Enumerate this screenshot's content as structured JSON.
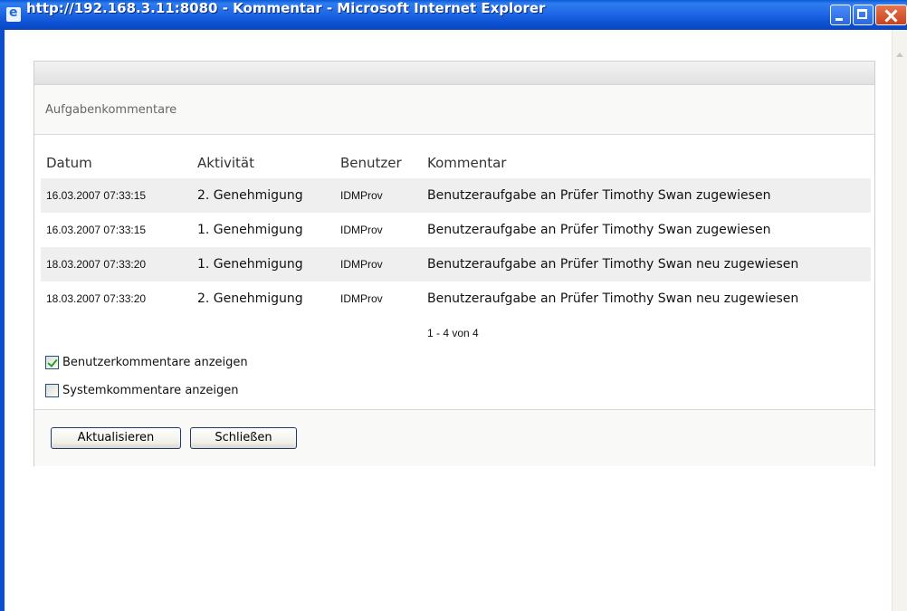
{
  "window": {
    "title": "http://192.168.3.11:8080 - Kommentar - Microsoft Internet Explorer"
  },
  "panel": {
    "title": "Aufgabenkommentare"
  },
  "table": {
    "columns": [
      "Datum",
      "Aktivität",
      "Benutzer",
      "Kommentar"
    ],
    "rows": [
      {
        "date": "16.03.2007 07:33:15",
        "activity": "2. Genehmigung",
        "user": "IDMProv",
        "comment": "Benutzeraufgabe an Prüfer Timothy Swan zugewiesen"
      },
      {
        "date": "16.03.2007 07:33:15",
        "activity": "1. Genehmigung",
        "user": "IDMProv",
        "comment": "Benutzeraufgabe an Prüfer Timothy Swan zugewiesen"
      },
      {
        "date": "18.03.2007 07:33:20",
        "activity": "1. Genehmigung",
        "user": "IDMProv",
        "comment": "Benutzeraufgabe an Prüfer Timothy Swan neu zugewiesen"
      },
      {
        "date": "18.03.2007 07:33:20",
        "activity": "2. Genehmigung",
        "user": "IDMProv",
        "comment": "Benutzeraufgabe an Prüfer Timothy Swan neu zugewiesen"
      }
    ],
    "pager": "1 - 4 von 4"
  },
  "options": {
    "user_comments": {
      "label": "Benutzerkommentare anzeigen",
      "checked": true
    },
    "system_comments": {
      "label": "Systemkommentare anzeigen",
      "checked": false
    }
  },
  "buttons": {
    "refresh": "Aktualisieren",
    "close": "Schließen"
  },
  "colors": {
    "titlebar": "#0b4fd0",
    "row_shade": "#efefef",
    "check": "#21a121"
  }
}
